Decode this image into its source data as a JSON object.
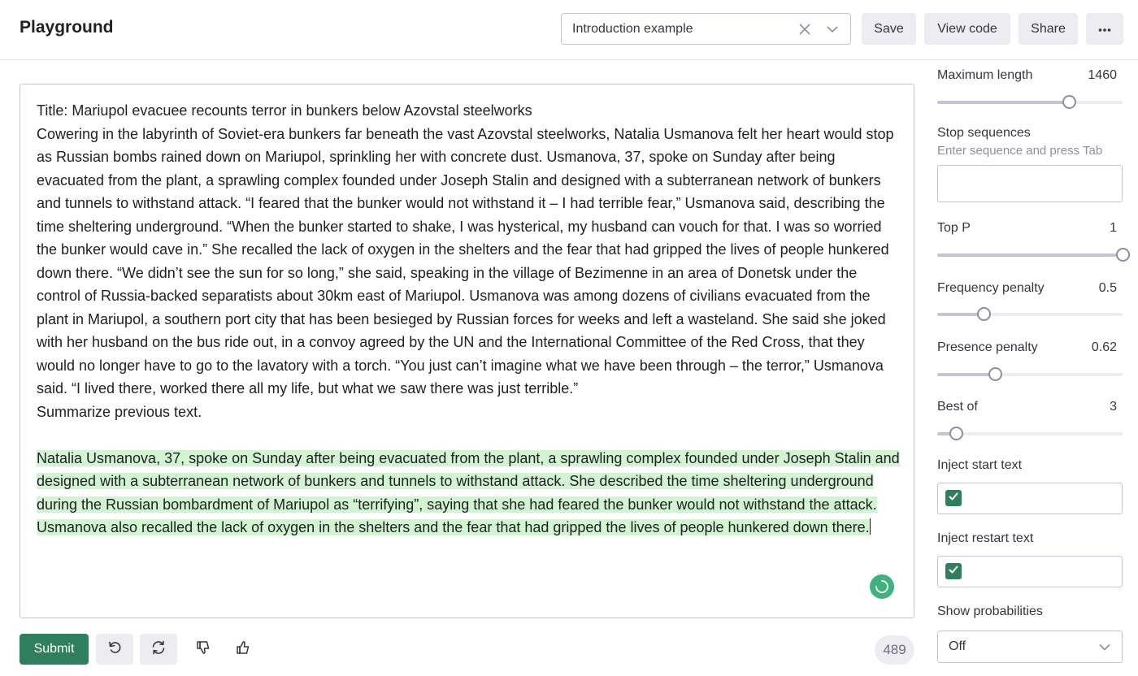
{
  "header": {
    "title": "Playground",
    "preset_value": "Introduction example",
    "save_label": "Save",
    "view_code_label": "View code",
    "share_label": "Share",
    "more_label": "···"
  },
  "editor": {
    "prompt_title": "Title: Mariupol evacuee recounts terror in bunkers below Azovstal steelworks",
    "prompt_body": "Cowering in the labyrinth of Soviet-era bunkers far beneath the vast Azovstal steelworks, Natalia Usmanova felt her heart would stop as Russian bombs rained down on Mariupol, sprinkling her with concrete dust. Usmanova, 37, spoke on Sunday after being evacuated from the plant, a sprawling complex founded under Joseph Stalin and designed with a subterranean network of bunkers and tunnels to withstand attack. “I feared that the bunker would not withstand it – I had terrible fear,” Usmanova said, describing the time sheltering underground. “When the bunker started to shake, I was hysterical, my husband can vouch for that. I was so worried the bunker would cave in.” She recalled the lack of oxygen in the shelters and the fear that had gripped the lives of people hunkered down there. “We didn’t see the sun for so long,” she said, speaking in the village of Bezimenne in an area of Donetsk under the control of Russia-backed separatists about 30km east of Mariupol. Usmanova was among dozens of civilians evacuated from the plant in Mariupol, a southern port city that has been besieged by Russian forces for weeks and left a wasteland. She said she joked with her husband on the bus ride out, in a convoy agreed by the UN and the International Committee of the Red Cross, that they would no longer have to go to the lavatory with a torch. “You just can’t imagine what we have been through – the terror,” Usmanova said. “I lived there, worked there all my life, but what we saw there was just terrible.”",
    "instruction": "Summarize previous text.",
    "completion": "Natalia Usmanova, 37, spoke on Sunday after being evacuated from the plant, a sprawling complex founded under Joseph Stalin and designed with a subterranean network of bunkers and tunnels to withstand attack. She described the time sheltering underground during the Russian bombardment of Mariupol as “terrifying”, saying that she had feared the bunker would not withstand the attack. Usmanova also recalled the lack of oxygen in the shelters and the fear that had gripped the lives of people hunkered down there."
  },
  "footer": {
    "submit_label": "Submit",
    "token_count": "489"
  },
  "settings": {
    "max_length": {
      "label": "Maximum length",
      "value": "1460",
      "fraction": 0.71
    },
    "stop_sequences": {
      "label": "Stop sequences",
      "hint": "Enter sequence and press Tab"
    },
    "top_p": {
      "label": "Top P",
      "value": "1",
      "fraction": 1.0
    },
    "frequency_penalty": {
      "label": "Frequency penalty",
      "value": "0.5",
      "fraction": 0.25
    },
    "presence_penalty": {
      "label": "Presence penalty",
      "value": "0.62",
      "fraction": 0.31
    },
    "best_of": {
      "label": "Best of",
      "value": "3",
      "fraction": 0.1
    },
    "inject_start": {
      "label": "Inject start text",
      "checked": true
    },
    "inject_restart": {
      "label": "Inject restart text",
      "checked": true
    },
    "show_probabilities": {
      "label": "Show probabilities",
      "value": "Off"
    }
  },
  "colors": {
    "accent": "#2f7f5f",
    "completion_highlight": "#d2f4d3",
    "button_bg": "#ececf1"
  },
  "icons": {
    "preset_clear": "close-icon",
    "preset_dropdown": "chevron-down-icon",
    "more": "more-icon",
    "undo": "undo-icon",
    "regenerate": "regenerate-icon",
    "thumbs_down": "thumbs-down-icon",
    "thumbs_up": "thumbs-up-icon",
    "spinner": "spinner-icon",
    "checkbox": "check-icon"
  }
}
